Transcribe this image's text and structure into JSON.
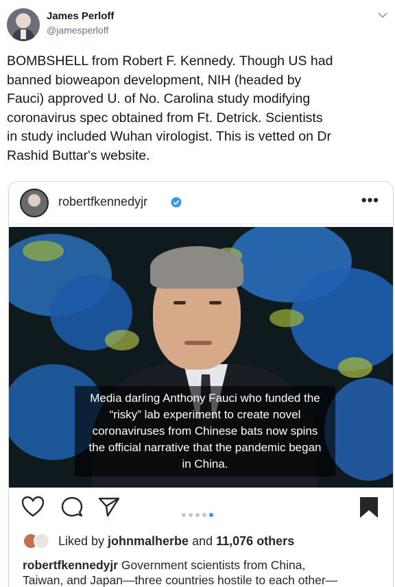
{
  "tweet": {
    "display_name": "James Perloff",
    "handle": "@jamesperloff",
    "text_lines": [
      "BOMBSHELL from Robert F. Kennedy. Though US had",
      "banned bioweapon development, NIH (headed by",
      "Fauci) approved U. of No. Carolina study modifying",
      "coronavirus spec obtained from Ft. Detrick. Scientists",
      "in study included Wuhan virologist. This is vetted on Dr",
      "Rashid Buttar's website."
    ]
  },
  "instagram": {
    "username": "robertfkennedyjr",
    "more_label": "•••",
    "image_caption_lines": [
      "Media darling Anthony Fauci who funded the",
      "“risky” lab experiment to create novel",
      "coronaviruses from Chinese bats  now spins",
      "the official narrative that the pandemic began",
      "in China."
    ],
    "likes": {
      "prefix": "Liked by ",
      "user": "johnmalherbe",
      "middle": " and ",
      "count": "11,076 others"
    },
    "caption": {
      "username": "robertfkennedyjr",
      "line1": " Government scientists from China,",
      "line2": "Taiwan, and Japan—three countries hostile to each other—"
    },
    "carousel": {
      "total": 5,
      "active_index": 4
    }
  },
  "colors": {
    "verified_blue": "#3897f0",
    "twitter_gray": "#657786",
    "text_dark": "#14171a"
  },
  "icons": [
    "chevron-down-icon",
    "verified-badge-icon",
    "more-options-icon",
    "heart-icon",
    "comment-icon",
    "share-icon",
    "bookmark-icon"
  ]
}
